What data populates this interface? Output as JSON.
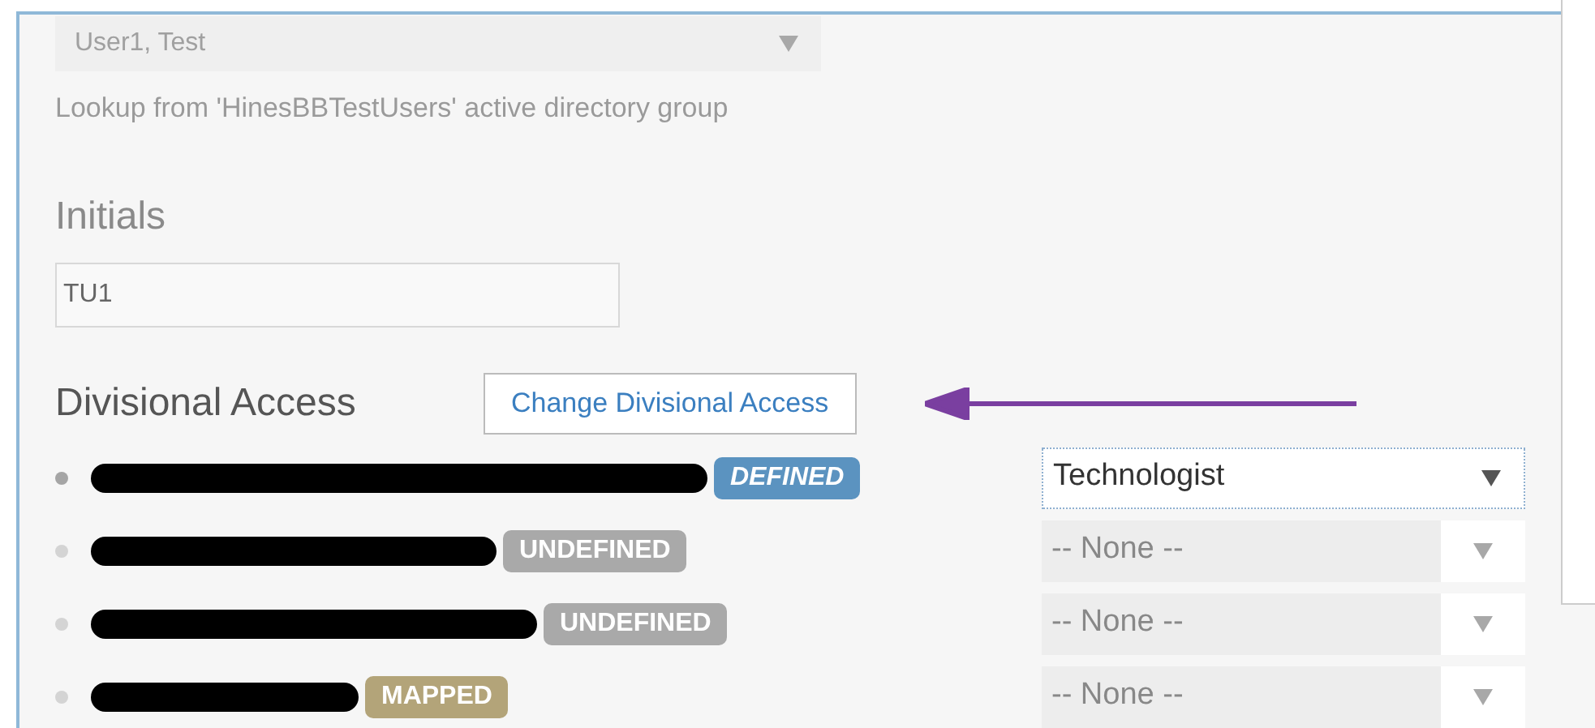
{
  "user_select": {
    "value": "User1, Test",
    "disabled": true
  },
  "lookup_hint": "Lookup from 'HinesBBTestUsers' active directory group",
  "initials": {
    "label": "Initials",
    "value": "TU1"
  },
  "divisional_access": {
    "heading": "Divisional Access",
    "button": "Change Divisional Access",
    "divisions": [
      {
        "badge": "DEFINED",
        "kind": "defined",
        "role": "Technologist",
        "enabled": true
      },
      {
        "badge": "UNDEFINED",
        "kind": "undefined",
        "role": "-- None --",
        "enabled": false
      },
      {
        "badge": "UNDEFINED",
        "kind": "undefined",
        "role": "-- None --",
        "enabled": false
      },
      {
        "badge": "MAPPED",
        "kind": "mapped",
        "role": "-- None --",
        "enabled": false
      }
    ]
  }
}
